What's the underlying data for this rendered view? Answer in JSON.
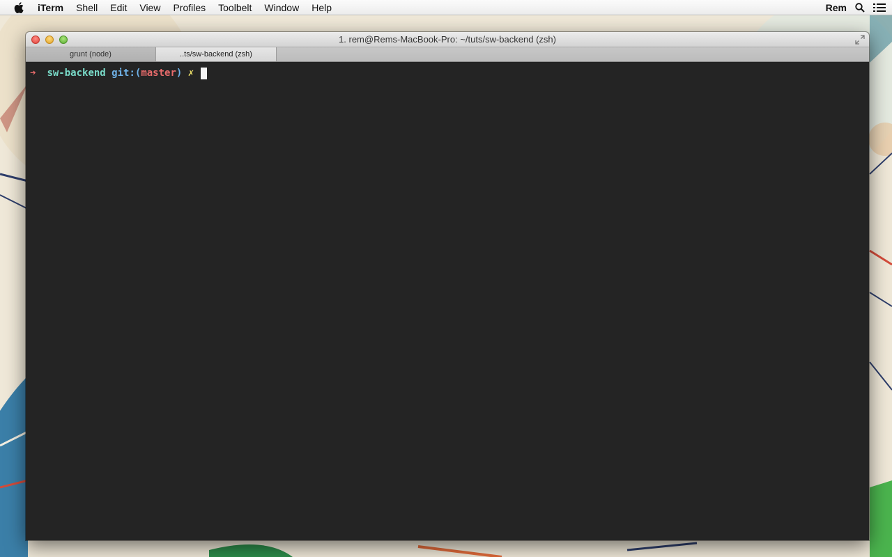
{
  "menubar": {
    "apple_icon": "apple-logo-icon",
    "app_name": "iTerm",
    "items": [
      "Shell",
      "Edit",
      "View",
      "Profiles",
      "Toolbelt",
      "Window",
      "Help"
    ],
    "user": "Rem",
    "search_icon": "search-icon",
    "list_icon": "notification-list-icon"
  },
  "window": {
    "title": "1. rem@Rems-MacBook-Pro: ~/tuts/sw-backend (zsh)",
    "tabs": [
      {
        "label": "grunt (node)",
        "active": false
      },
      {
        "label": "..ts/sw-backend (zsh)",
        "active": true
      }
    ]
  },
  "terminal": {
    "prompt_arrow": "➜",
    "directory": "sw-backend",
    "git_label": "git:",
    "branch_open": "(",
    "branch": "master",
    "branch_close": ")",
    "dirty_mark": "✗"
  },
  "colors": {
    "terminal_bg": "#242424",
    "arrow": "#e86b6b",
    "directory": "#79dac8",
    "git": "#6fb2e8",
    "branch": "#e86b6b",
    "dirty": "#f0e36a"
  }
}
